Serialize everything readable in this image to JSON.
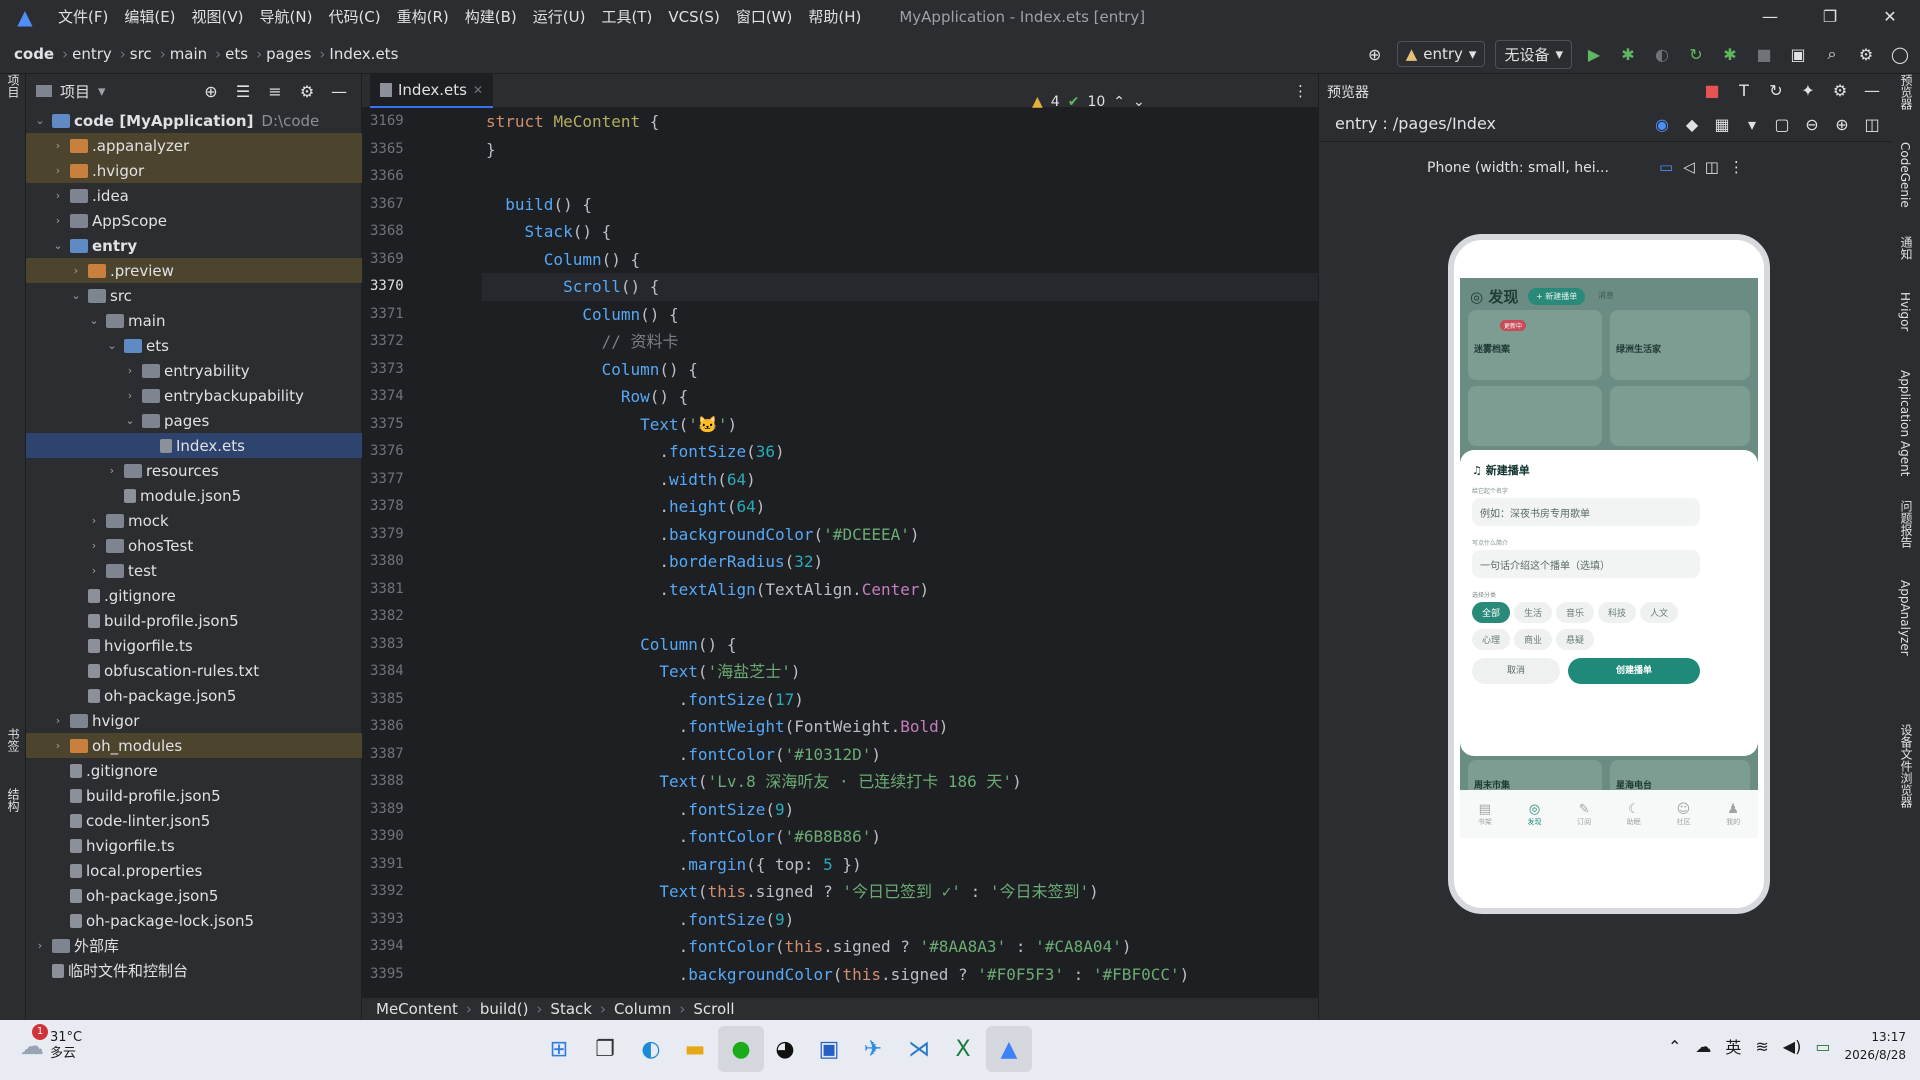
{
  "titlebar": {
    "menus": [
      "文件(F)",
      "编辑(E)",
      "视图(V)",
      "导航(N)",
      "代码(C)",
      "重构(R)",
      "构建(B)",
      "运行(U)",
      "工具(T)",
      "VCS(S)",
      "窗口(W)",
      "帮助(H)"
    ],
    "title": "MyApplication - Index.ets [entry]"
  },
  "breadcrumb": [
    "code",
    "entry",
    "src",
    "main",
    "ets",
    "pages",
    "Index.ets"
  ],
  "toolbar": {
    "module": "entry",
    "device": "无设备"
  },
  "leftstrip": {
    "project": "项目",
    "bookmarks": "书签",
    "structure": "结构"
  },
  "project": {
    "title": "项目",
    "tree": [
      {
        "label": "code [MyApplication]",
        "extra": "D:\\code",
        "depth": 0,
        "arrow": "v",
        "type": "b",
        "bold": true
      },
      {
        "label": ".appanalyzer",
        "depth": 1,
        "arrow": ">",
        "type": "o",
        "hl": true
      },
      {
        "label": ".hvigor",
        "depth": 1,
        "arrow": ">",
        "type": "o",
        "hl": true
      },
      {
        "label": ".idea",
        "depth": 1,
        "arrow": ">",
        "type": "g"
      },
      {
        "label": "AppScope",
        "depth": 1,
        "arrow": ">",
        "type": "g"
      },
      {
        "label": "entry",
        "depth": 1,
        "arrow": "v",
        "type": "b",
        "bold": true
      },
      {
        "label": ".preview",
        "depth": 2,
        "arrow": ">",
        "type": "o",
        "hl": true
      },
      {
        "label": "src",
        "depth": 2,
        "arrow": "v",
        "type": "g"
      },
      {
        "label": "main",
        "depth": 3,
        "arrow": "v",
        "type": "g"
      },
      {
        "label": "ets",
        "depth": 4,
        "arrow": "v",
        "type": "b"
      },
      {
        "label": "entryability",
        "depth": 5,
        "arrow": ">",
        "type": "g"
      },
      {
        "label": "entrybackupability",
        "depth": 5,
        "arrow": ">",
        "type": "g"
      },
      {
        "label": "pages",
        "depth": 5,
        "arrow": "v",
        "type": "g"
      },
      {
        "label": "Index.ets",
        "depth": 6,
        "arrow": "",
        "type": "f",
        "sel": true
      },
      {
        "label": "resources",
        "depth": 4,
        "arrow": ">",
        "type": "g"
      },
      {
        "label": "module.json5",
        "depth": 4,
        "arrow": "",
        "type": "f"
      },
      {
        "label": "mock",
        "depth": 3,
        "arrow": ">",
        "type": "g"
      },
      {
        "label": "ohosTest",
        "depth": 3,
        "arrow": ">",
        "type": "g"
      },
      {
        "label": "test",
        "depth": 3,
        "arrow": ">",
        "type": "g"
      },
      {
        "label": ".gitignore",
        "depth": 2,
        "arrow": "",
        "type": "f"
      },
      {
        "label": "build-profile.json5",
        "depth": 2,
        "arrow": "",
        "type": "f"
      },
      {
        "label": "hvigorfile.ts",
        "depth": 2,
        "arrow": "",
        "type": "f"
      },
      {
        "label": "obfuscation-rules.txt",
        "depth": 2,
        "arrow": "",
        "type": "f"
      },
      {
        "label": "oh-package.json5",
        "depth": 2,
        "arrow": "",
        "type": "f"
      },
      {
        "label": "hvigor",
        "depth": 1,
        "arrow": ">",
        "type": "g"
      },
      {
        "label": "oh_modules",
        "depth": 1,
        "arrow": ">",
        "type": "o",
        "hl": true
      },
      {
        "label": ".gitignore",
        "depth": 1,
        "arrow": "",
        "type": "f"
      },
      {
        "label": "build-profile.json5",
        "depth": 1,
        "arrow": "",
        "type": "f"
      },
      {
        "label": "code-linter.json5",
        "depth": 1,
        "arrow": "",
        "type": "f"
      },
      {
        "label": "hvigorfile.ts",
        "depth": 1,
        "arrow": "",
        "type": "f"
      },
      {
        "label": "local.properties",
        "depth": 1,
        "arrow": "",
        "type": "f"
      },
      {
        "label": "oh-package.json5",
        "depth": 1,
        "arrow": "",
        "type": "f"
      },
      {
        "label": "oh-package-lock.json5",
        "depth": 1,
        "arrow": "",
        "type": "f"
      },
      {
        "label": "外部库",
        "depth": 0,
        "arrow": ">",
        "type": "g"
      },
      {
        "label": "临时文件和控制台",
        "depth": 0,
        "arrow": "",
        "type": "f"
      }
    ]
  },
  "editor": {
    "tab": "Index.ets",
    "warnings": "4",
    "checks": "10",
    "lines": [
      {
        "n": "3169",
        "h": "<span class='kw'>struct</span> <span class='ty'>MeContent</span> {"
      },
      {
        "n": "3365",
        "h": "}"
      },
      {
        "n": "3366",
        "h": ""
      },
      {
        "n": "3367",
        "h": "  <span class='fn'>build</span>() {"
      },
      {
        "n": "3368",
        "h": "    <span class='fn'>Stack</span>() {"
      },
      {
        "n": "3369",
        "h": "      <span class='fn'>Column</span>() {"
      },
      {
        "n": "3370",
        "h": "        <span class='fn'>Scroll</span>() {",
        "cur": true
      },
      {
        "n": "3371",
        "h": "          <span class='fn'>Column</span>() {"
      },
      {
        "n": "3372",
        "h": "            <span class='cm'>// 资料卡</span>"
      },
      {
        "n": "3373",
        "h": "            <span class='fn'>Column</span>() {"
      },
      {
        "n": "3374",
        "h": "              <span class='fn'>Row</span>() {"
      },
      {
        "n": "3375",
        "h": "                <span class='fn'>Text</span>(<span class='st'>'🐱'</span>)"
      },
      {
        "n": "3376",
        "h": "                  .<span class='fn'>fontSize</span>(<span class='nu'>36</span>)"
      },
      {
        "n": "3377",
        "h": "                  .<span class='fn'>width</span>(<span class='nu'>64</span>)"
      },
      {
        "n": "3378",
        "h": "                  .<span class='fn'>height</span>(<span class='nu'>64</span>)"
      },
      {
        "n": "3379",
        "h": "                  .<span class='fn'>backgroundColor</span>(<span class='st'>'#DCEEEA'</span>)"
      },
      {
        "n": "3380",
        "h": "                  .<span class='fn'>borderRadius</span>(<span class='nu'>32</span>)"
      },
      {
        "n": "3381",
        "h": "                  .<span class='fn'>textAlign</span>(TextAlign.<span class='pr'>Center</span>)"
      },
      {
        "n": "3382",
        "h": ""
      },
      {
        "n": "3383",
        "h": "                <span class='fn'>Column</span>() {"
      },
      {
        "n": "3384",
        "h": "                  <span class='fn'>Text</span>(<span class='st'>'海盐芝士'</span>)"
      },
      {
        "n": "3385",
        "h": "                    .<span class='fn'>fontSize</span>(<span class='nu'>17</span>)"
      },
      {
        "n": "3386",
        "h": "                    .<span class='fn'>fontWeight</span>(FontWeight.<span class='pr'>Bold</span>)"
      },
      {
        "n": "3387",
        "h": "                    .<span class='fn'>fontColor</span>(<span class='st'>'#10312D'</span>)"
      },
      {
        "n": "3388",
        "h": "                  <span class='fn'>Text</span>(<span class='st'>'Lv.8 深海听友 · 已连续打卡 186 天'</span>)"
      },
      {
        "n": "3389",
        "h": "                    .<span class='fn'>fontSize</span>(<span class='nu'>9</span>)"
      },
      {
        "n": "3390",
        "h": "                    .<span class='fn'>fontColor</span>(<span class='st'>'#6B8B86'</span>)"
      },
      {
        "n": "3391",
        "h": "                    .<span class='fn'>margin</span>({ top: <span class='nu'>5</span> })"
      },
      {
        "n": "3392",
        "h": "                  <span class='fn'>Text</span>(<span class='kw'>this</span>.signed ? <span class='st'>'今日已签到 ✓'</span> : <span class='st'>'今日未签到'</span>)"
      },
      {
        "n": "3393",
        "h": "                    .<span class='fn'>fontSize</span>(<span class='nu'>9</span>)"
      },
      {
        "n": "3394",
        "h": "                    .<span class='fn'>fontColor</span>(<span class='kw'>this</span>.signed ? <span class='st'>'#8AA8A3'</span> : <span class='st'>'#CA8A04'</span>)"
      },
      {
        "n": "3395",
        "h": "                    .<span class='fn'>backgroundColor</span>(<span class='kw'>this</span>.signed ? <span class='st'>'#F0F5F3'</span> : <span class='st'>'#FBF0CC'</span>)"
      }
    ],
    "status": [
      "MeContent",
      "build()",
      "Stack",
      "Column",
      "Scroll"
    ]
  },
  "preview": {
    "title": "预览器",
    "path": "entry : /pages/Index",
    "device": "Phone (width: small, hei...",
    "app": {
      "header": "发现",
      "newbtn": "+ 新建播单",
      "msg": "消息",
      "cards": [
        {
          "t": "迷雾档案",
          "tag": "更新中"
        },
        {
          "t": "绿洲生活家",
          "tag": ""
        },
        {
          "t": "周末市集",
          "tag": ""
        },
        {
          "t": "星海电台",
          "tag": ""
        }
      ],
      "sheet": {
        "title": "新建播单",
        "nameLabel": "给它起个名字",
        "namePh": "例如：深夜书房专用歌单",
        "descLabel": "写点什么简介",
        "descPh": "一句话介绍这个播单（选填）",
        "catLabel": "选择分类",
        "chips": [
          "全部",
          "生活",
          "音乐",
          "科技",
          "人文",
          "心理",
          "商业",
          "悬疑"
        ],
        "cancel": "取消",
        "create": "创建播单"
      },
      "nav": [
        "书架",
        "发现",
        "订阅",
        "助眠",
        "社区",
        "我的"
      ]
    }
  },
  "rightstrip": [
    "预览器",
    "CodeGenie",
    "通知",
    "Hvigor",
    "Application Agent",
    "问题报告",
    "AppAnalyzer",
    "设备文件浏览器"
  ],
  "taskbar": {
    "temp": "31°C",
    "weather": "多云",
    "badge": "1",
    "ime": "英",
    "time": "13:17",
    "date": "2026/8/28"
  }
}
